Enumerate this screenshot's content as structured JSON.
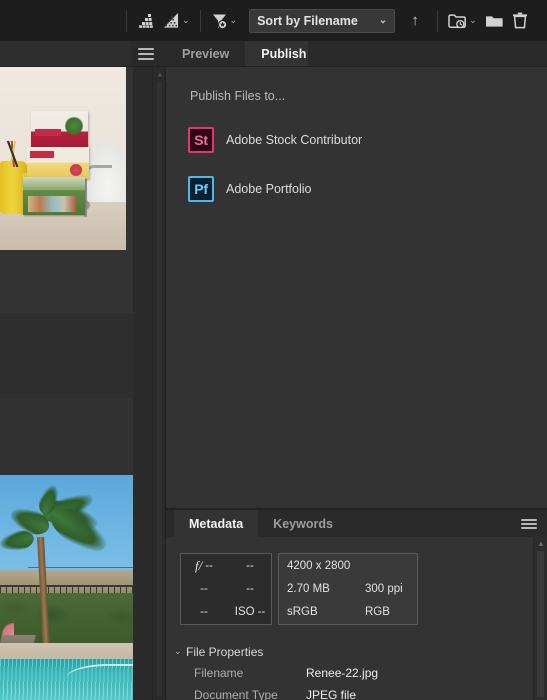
{
  "toolbar": {
    "rating_filter_icon": "rating-stack-icon",
    "rating_sort_icon": "rating-stack-dropdown-icon",
    "filter_icon": "filter-funnel-icon",
    "sort_value": "Sort by Filename",
    "sort_chevron": "⌄",
    "ascending_label": "↑",
    "recent_folder_icon": "folder-clock-icon",
    "new_folder_icon": "new-folder-icon",
    "delete_icon": "trash-icon",
    "chevron": "⌄"
  },
  "panel_menu": {
    "icon": "hamburger-menu-icon"
  },
  "main_tabs": [
    {
      "label": "Preview",
      "active": false
    },
    {
      "label": "Publish",
      "active": true
    }
  ],
  "publish": {
    "title": "Publish Files to...",
    "services": [
      {
        "badge": "St",
        "label": "Adobe Stock Contributor",
        "accent": "#e8336d"
      },
      {
        "badge": "Pf",
        "label": "Adobe Portfolio",
        "accent": "#49b8ef"
      }
    ]
  },
  "metadata": {
    "tabs": [
      {
        "label": "Metadata",
        "active": true
      },
      {
        "label": "Keywords",
        "active": false
      }
    ],
    "menu_icon": "hamburger-menu-icon",
    "camera_info": {
      "aperture_prefix": "f/",
      "aperture": "--",
      "shutter": "--",
      "exposure_comp": "--",
      "focal_length": "--",
      "metering": "--",
      "iso_label": "ISO",
      "iso": "--"
    },
    "file_info": {
      "dimensions": "4200 x 2800",
      "file_size": "2.70 MB",
      "resolution": "300 ppi",
      "color_profile": "sRGB",
      "color_mode": "RGB"
    },
    "sections": [
      {
        "title": "File Properties",
        "caret": "⌄",
        "expanded": true,
        "rows": [
          {
            "key": "Filename",
            "value": "Renee-22.jpg"
          },
          {
            "key": "Document Type",
            "value": "JPEG file"
          }
        ]
      }
    ]
  },
  "thumbnails": [
    {
      "name": "thumbnail-tea-boxes",
      "selected": true
    },
    {
      "name": "thumbnail-palm-pool",
      "selected": false
    }
  ],
  "colors": {
    "window_bg": "#262626",
    "toolbar_bg": "#1d1d1d",
    "panel_bg": "#333333",
    "tabstrip_bg": "#2a2a2a",
    "text_primary": "#ececec",
    "text_muted": "#aeaeae",
    "stock_accent": "#e8336d",
    "portfolio_accent": "#49b8ef"
  }
}
